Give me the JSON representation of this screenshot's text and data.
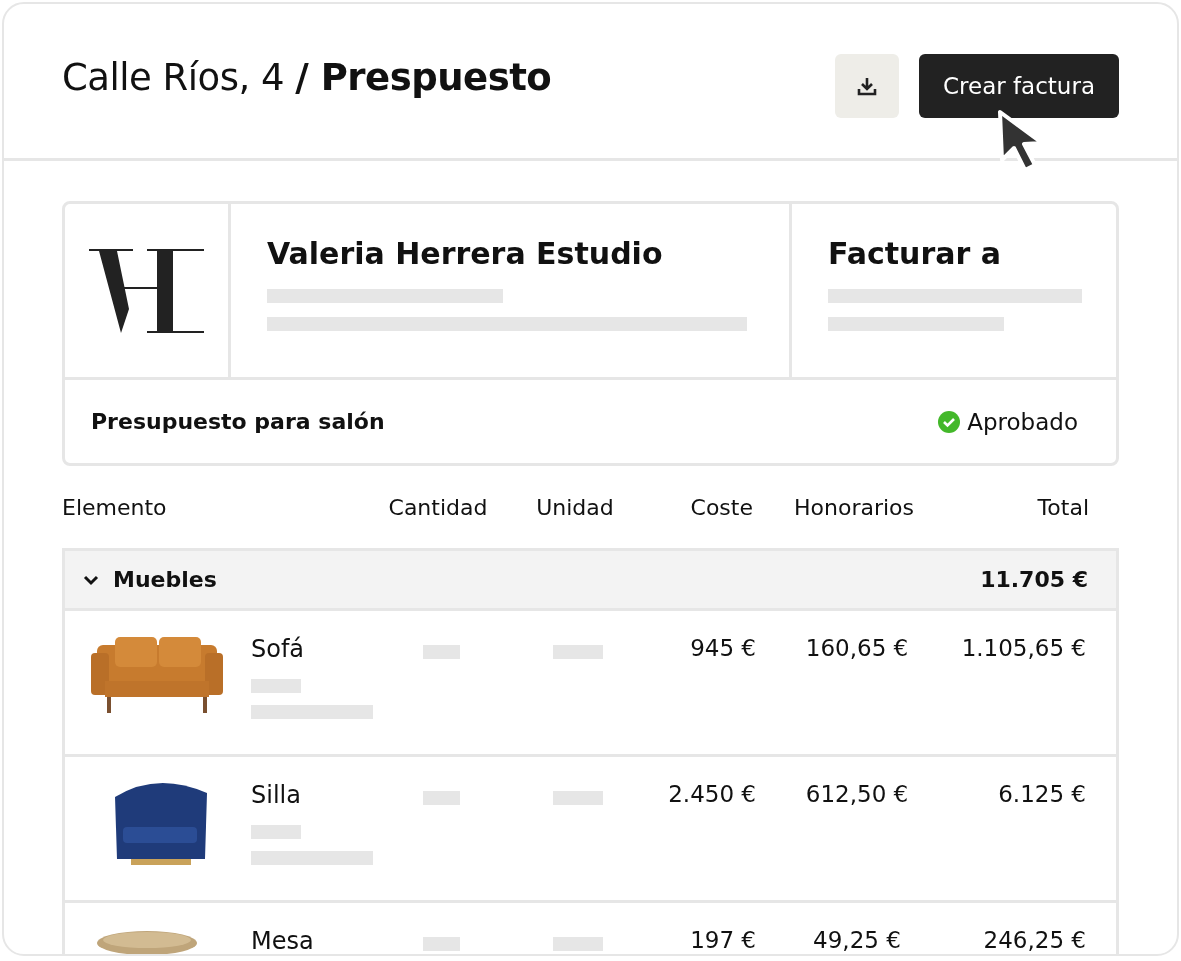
{
  "header": {
    "title": "Calle Ríos, 4 **/ Prespuesto**",
    "buttons": [
      {
        "kind": "download"
      },
      {
        "kind": "primary",
        "label": "Crear factura"
      }
    ]
  },
  "quote_card": {
    "company": {
      "name": "Valeria Herrera Estudio"
    },
    "bill_to": {
      "title": "Facturar a"
    },
    "description": "Presupuesto para salón",
    "status": {
      "kind": "approved",
      "label": "Aprobado"
    }
  },
  "table": {
    "columns": [
      "Elemento",
      "Cantidad",
      "Unidad",
      "Coste",
      "Honorarios",
      "Total"
    ],
    "groups": [
      {
        "name": "Muebles",
        "total": "11.705 €",
        "expanded": true,
        "rows": [
          {
            "kind": "sofa",
            "name": "Sofá",
            "cost": "945 €",
            "fee": "160,65 €",
            "total": "1.105,65 €"
          },
          {
            "kind": "chair",
            "name": "Silla",
            "cost": "2.450 €",
            "fee": "612,50 €",
            "total": "6.125 €"
          },
          {
            "kind": "table",
            "name": "Mesa",
            "cost": "197 €",
            "fee": "49,25 €",
            "total": "246,25 €"
          }
        ]
      }
    ]
  }
}
